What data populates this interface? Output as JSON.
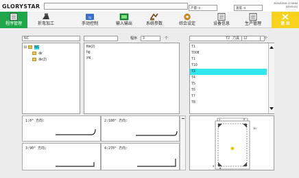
{
  "brand": "GLORYSTAR",
  "status": {
    "output_label": "产量: 0",
    "speed_label": "速度: 0",
    "date": "2024/10/15 17:28:54",
    "time": "(00:00:11)"
  },
  "toolbar": [
    {
      "label": "程序管理",
      "icon": "program-icon",
      "active": true
    },
    {
      "label": "折弯加工",
      "icon": "bending-icon"
    },
    {
      "label": "手动控制",
      "icon": "manual-icon"
    },
    {
      "label": "输入输出",
      "icon": "io-icon"
    },
    {
      "label": "系统参数",
      "icon": "system-params-icon"
    },
    {
      "label": "综合设定",
      "icon": "settings-icon"
    },
    {
      "label": "设备信息",
      "icon": "device-info-icon"
    },
    {
      "label": "生产管理",
      "icon": "production-icon"
    },
    {
      "label": "退 出",
      "icon": "exit-icon",
      "exit": true
    }
  ],
  "header": {
    "path": "NC",
    "filter_value": "",
    "count_label": "程序",
    "count_value": "3",
    "count_unit": "个",
    "tool_search": "T2",
    "tool_count_label": "刀具",
    "tool_count_value": "12",
    "tool_count_unit": "个"
  },
  "tree": {
    "root": "NC",
    "children": [
      "dir",
      "dir(2)"
    ]
  },
  "files": [
    "file(2)",
    "hg",
    "yuj"
  ],
  "tools": [
    "T1",
    "T008",
    "T1",
    "T10",
    "T2",
    "T4",
    "T5",
    "T6",
    "T7",
    "T8"
  ],
  "tools_selected_index": 4,
  "directions": [
    {
      "label": "1:0° 方向:"
    },
    {
      "label": "2:180° 方向:"
    },
    {
      "label": "3:90° 方向:"
    },
    {
      "label": "4:270° 方向:"
    }
  ],
  "preview": {
    "top_labels": [
      "1",
      "2"
    ],
    "right_label": "10",
    "left_label": "3",
    "bottom_label": "8",
    "marker_color": "#e8c400"
  }
}
